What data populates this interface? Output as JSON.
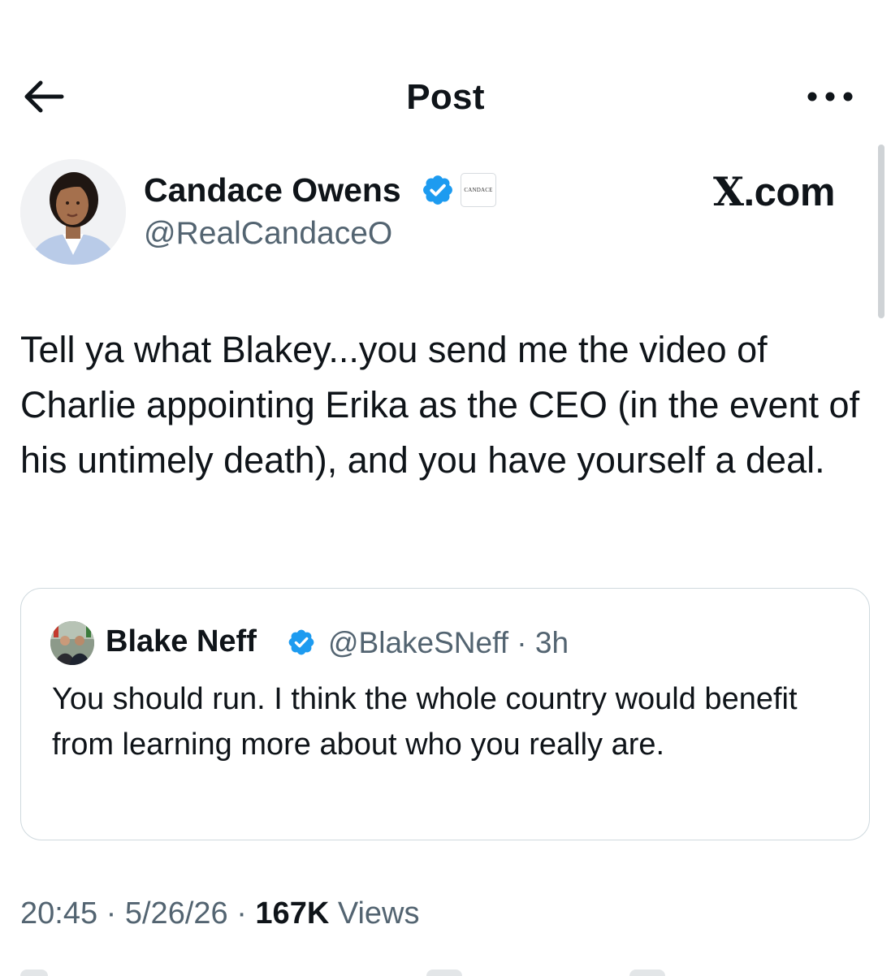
{
  "header": {
    "title": "Post"
  },
  "author": {
    "name": "Candace Owens",
    "handle": "@RealCandaceO",
    "affiliate_badge": "CANDACE",
    "avatar_icon": "candace-avatar"
  },
  "watermark": {
    "x_letter": "X",
    "suffix": ".com"
  },
  "post": {
    "text": "Tell ya what Blakey...you send me the video of Charlie appointing Erika as the CEO (in the event of his untimely death), and you have yourself a deal."
  },
  "quote": {
    "name": "Blake Neff",
    "handle_time": "@BlakeSNeff · 3h",
    "text": "You should run. I think the whole country would benefit from learning more about who you really are."
  },
  "meta": {
    "time_date": "20:45 · 5/26/26 · ",
    "views_count": "167K",
    "views_label": " Views"
  },
  "colors": {
    "verified_blue": "#1d9bf0",
    "secondary_text": "#536471",
    "primary_text": "#0f1419",
    "card_border": "#cfd9de"
  }
}
